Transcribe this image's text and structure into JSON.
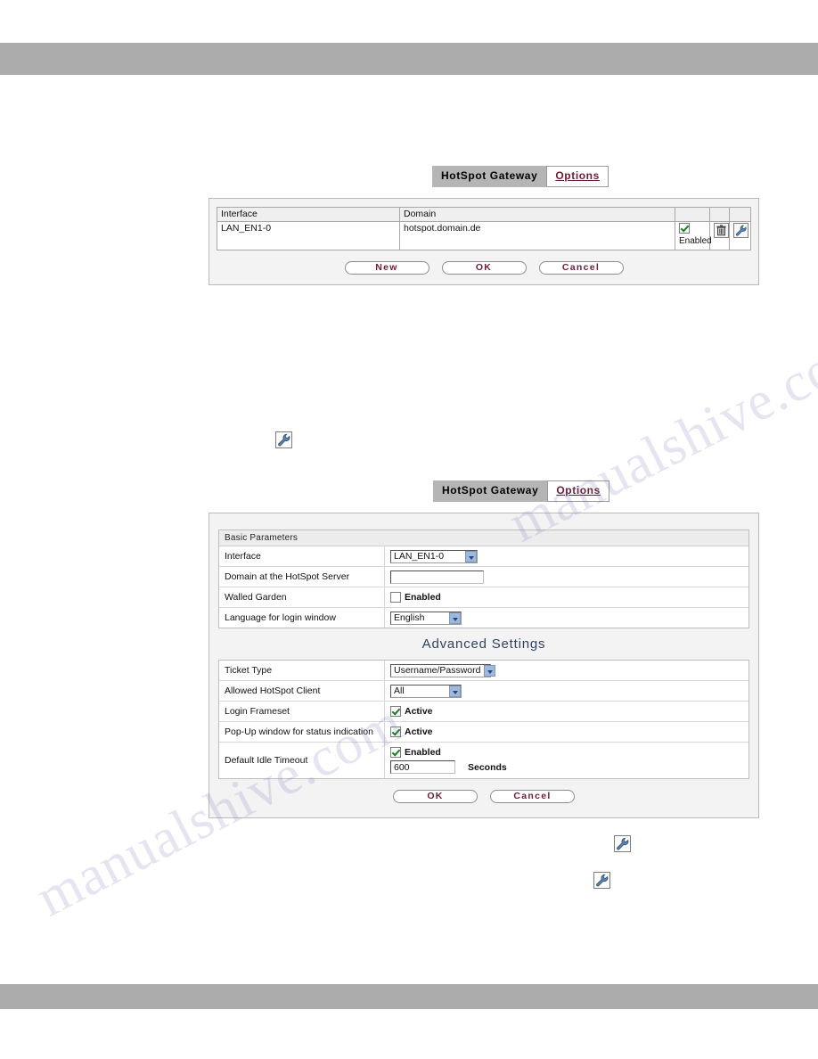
{
  "page": {
    "top_bar_color": "#acacac",
    "bottom_bar_color": "#acacac",
    "watermark_text": "manualshive.com",
    "accent_link_color": "#6b1d35",
    "heading_color": "#2f4462"
  },
  "tabs": {
    "active_label": "HotSpot Gateway",
    "inactive_label": "Options"
  },
  "overview_panel": {
    "table": {
      "headers": [
        "Interface",
        "Domain",
        "",
        "",
        ""
      ],
      "rows": [
        {
          "interface": "LAN_EN1-0",
          "domain": "hotspot.domain.de",
          "state_checked": true,
          "state_label": "Enabled",
          "delete_icon": "trash-icon",
          "edit_icon": "wrench-icon"
        }
      ]
    },
    "buttons": [
      "New",
      "OK",
      "Cancel"
    ]
  },
  "settings_panel": {
    "basic_section": {
      "title": "Basic Parameters",
      "rows": [
        {
          "label": "Interface",
          "control": "select",
          "value": "LAN_EN1-0"
        },
        {
          "label": "Domain at the HotSpot Server",
          "control": "text",
          "value": "",
          "placeholder": ""
        },
        {
          "label": "Walled Garden",
          "control": "checkbox",
          "checked": false,
          "checkbox_label": "Enabled"
        },
        {
          "label": "Language for login window",
          "control": "select",
          "value": "English"
        }
      ]
    },
    "advanced_section": {
      "title": "Advanced Settings",
      "rows": [
        {
          "label": "Ticket Type",
          "control": "select",
          "value": "Username/Password"
        },
        {
          "label": "Allowed HotSpot Client",
          "control": "select",
          "value": "All"
        },
        {
          "label": "Login Frameset",
          "control": "checkbox",
          "checked": true,
          "checkbox_label": "Active"
        },
        {
          "label": "Pop-Up window for status indication",
          "control": "checkbox",
          "checked": true,
          "checkbox_label": "Active"
        },
        {
          "label": "Default Idle Timeout",
          "control": "checkbox-and-text",
          "checked": true,
          "checkbox_label": "Enabled",
          "value": "600",
          "units": "Seconds"
        }
      ]
    },
    "buttons": [
      "OK",
      "Cancel"
    ]
  },
  "standalone_icons": [
    {
      "name": "wrench-icon"
    },
    {
      "name": "wrench-icon"
    },
    {
      "name": "wrench-icon"
    }
  ]
}
